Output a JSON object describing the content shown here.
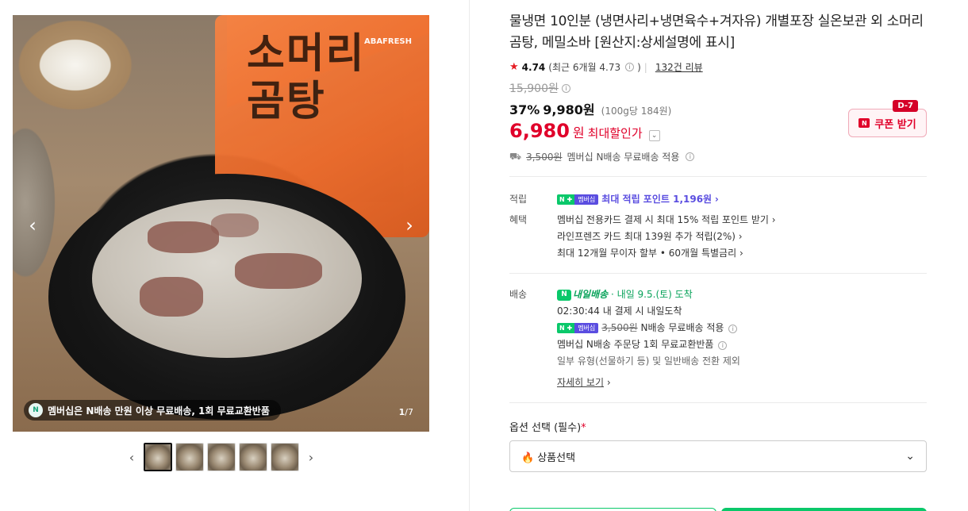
{
  "gallery": {
    "promo_badge": "N",
    "promo_text": "멤버십은 N배송 만원 이상 무료배송, 1회 무료교환반품",
    "counter_current": "1",
    "counter_total": "/7",
    "pouch_text": "소머리\n곰탕",
    "pouch_brand": "ABAFRESH"
  },
  "product": {
    "title": "물냉면 10인분 (냉면사리+냉면육수+겨자유) 개별포장 실온보관 외 소머리곰탕, 메밀소바 [원산지:상세설명에 표시]",
    "rating": "4.74",
    "rating_recent": "(최근 6개월 4.73",
    "rating_recent_close": ")",
    "review_count": "132건 리뷰",
    "original_price": "15,900원",
    "discount": "37%",
    "sale_price": "9,980원",
    "unit_price": "(100g당 184원)",
    "max_price": "6,980",
    "max_price_unit": "원",
    "max_label": "최대할인가",
    "shipping_old": "3,500원",
    "shipping_text": "멤버십 N배송 무료배송 적용"
  },
  "coupon": {
    "dday": "D-7",
    "label": "쿠폰 받기"
  },
  "points": {
    "label": "적립",
    "badge_n": "N ✚",
    "badge_member": "멤버십",
    "text": "최대 적립 포인트 1,196원"
  },
  "benefits": {
    "label": "혜택",
    "items": [
      "멤버십 전용카드 결제 시 최대 15% 적립 포인트 받기",
      "라인프렌즈 카드 최대 139원 추가 적립(2%)",
      "최대 12개월 무이자 할부 • 60개월 특별금리"
    ]
  },
  "delivery": {
    "label": "배송",
    "service": "내일배송",
    "arrival": "내일 9.5.(토) 도착",
    "countdown": "02:30:44",
    "countdown_text": "내 결제 시 내일도착",
    "badge_n": "N ✚",
    "badge_member": "멤버십",
    "fee_old": "3,500원",
    "fee_text": "N배송 무료배송 적용",
    "return_text": "멤버십 N배송 주문당 1회 무료교환반품",
    "exclusion": "일부 유형(선물하기 등) 및 일반배송 전환 제외",
    "details_link": "자세히 보기"
  },
  "options": {
    "label": "옵션 선택 (필수)",
    "required_mark": "*",
    "select_value": "상품선택"
  },
  "colors": {
    "accent_red": "#e0002a",
    "naver_green": "#0ac86a",
    "member_purple": "#5a4de0"
  }
}
